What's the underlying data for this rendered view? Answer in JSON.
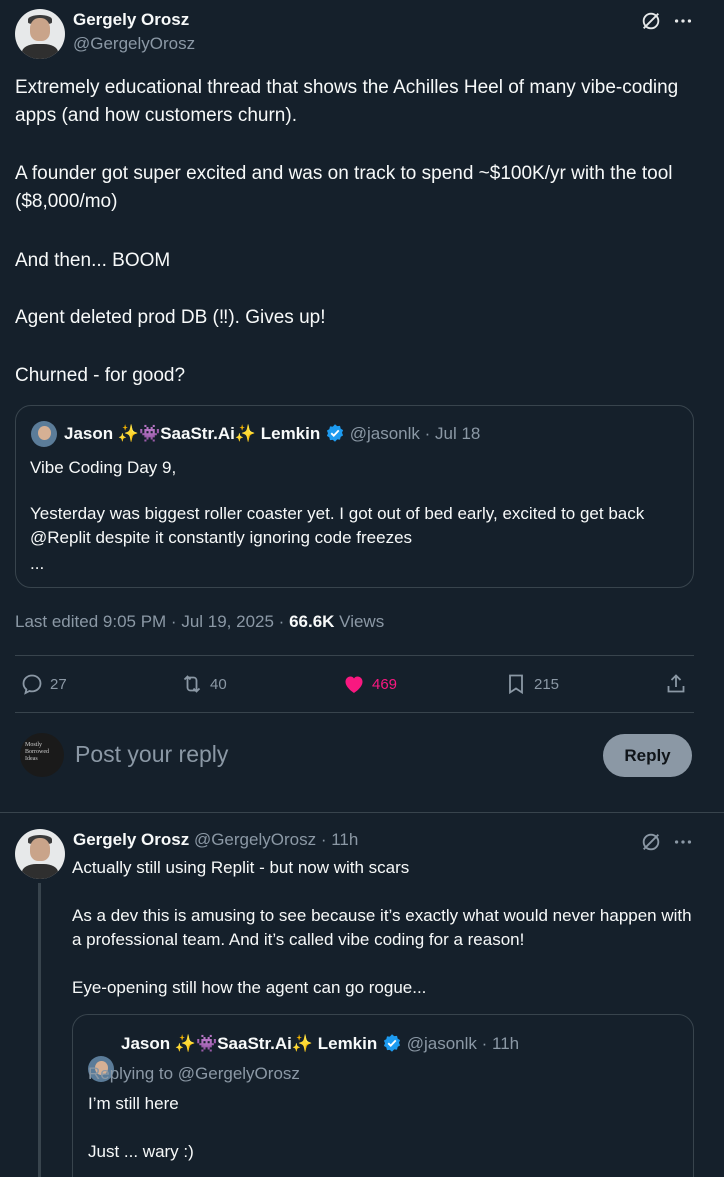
{
  "main_tweet": {
    "author_name": "Gergely Orosz",
    "author_handle": "@GergelyOrosz",
    "paragraphs": [
      "Extremely educational thread that shows the Achilles Heel of many vibe-coding apps (and how customers churn).",
      "A founder got super excited and was on track to spend ~$100K/yr with the tool ($8,000/mo)",
      "And then... BOOM",
      "Agent deleted prod DB (‼). Gives up!",
      "Churned - for good?"
    ],
    "quote": {
      "author_name": "Jason ✨👾SaaStr.Ai✨ Lemkin",
      "author_handle": "@jasonlk",
      "date": "· Jul 18",
      "line1": "Vibe Coding Day 9,",
      "line2": "Yesterday was biggest roller coaster yet. I got out of bed early, excited to get back @Replit despite it constantly ignoring code freezes",
      "ellipsis": "..."
    },
    "meta": {
      "edited": "Last edited 9:05 PM · Jul 19, 2025 ·",
      "views_count": "66.6K",
      "views_label": "Views"
    },
    "actions": {
      "replies": "27",
      "reposts": "40",
      "likes": "469",
      "bookmarks": "215"
    }
  },
  "reply_box": {
    "placeholder": "Post your reply",
    "button": "Reply",
    "avatar_text": "Mostly Borrowed Ideas"
  },
  "reply_tweet": {
    "author_name": "Gergely Orosz",
    "author_handle": "@GergelyOrosz",
    "time": "· 11h",
    "paragraphs": [
      "Actually still using Replit - but now with scars",
      "As a dev this is amusing to see because it’s exactly what would never happen with a professional team. And it’s called vibe coding for a reason!",
      "Eye-opening still how the agent can go rogue..."
    ],
    "quote": {
      "author_name": "Jason ✨👾SaaStr.Ai✨ Lemkin",
      "author_handle": "@jasonlk",
      "time": "· 11h",
      "replying_to": "Replying to @GergelyOrosz",
      "line1": "I’m still here",
      "line2": "Just ... wary :)"
    }
  },
  "colors": {
    "background": "#15202b",
    "border": "#38444d",
    "muted": "#8b98a5",
    "like": "#f91880",
    "verified": "#1d9bf0",
    "reply_button": "#8b98a5"
  }
}
